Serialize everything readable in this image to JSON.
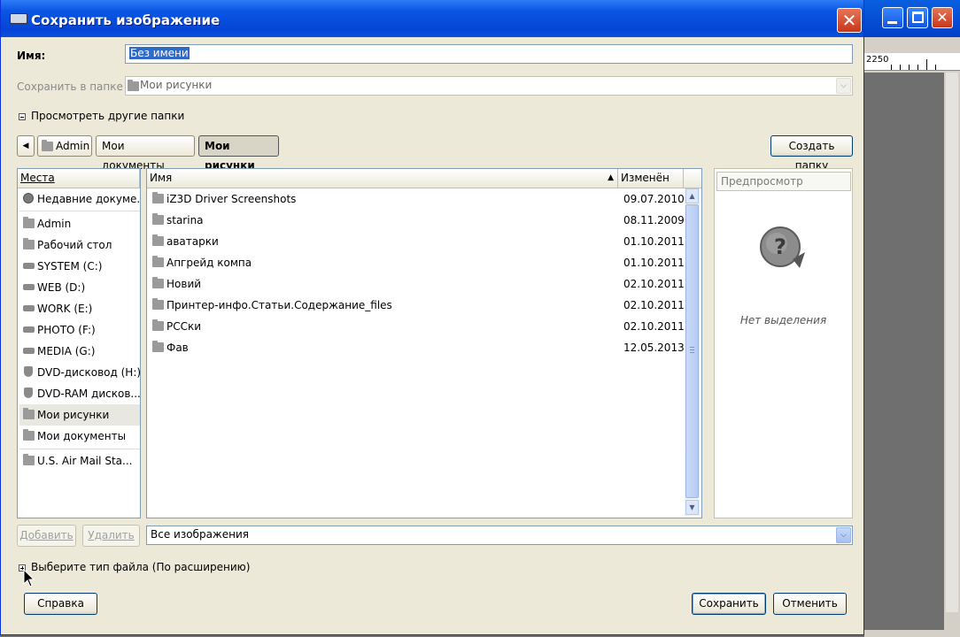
{
  "background_app": {
    "ruler_label": "2250"
  },
  "dialog": {
    "title": "Сохранить изображение",
    "name_label": "Имя:",
    "name_value": "Без имени",
    "folder_label": "Сохранить в папке",
    "folder_value": "Мои рисунки",
    "browse_expander": "Просмотреть другие папки",
    "path": [
      "Admin",
      "Мои документы",
      "Мои рисунки"
    ],
    "create_folder_label": "Создать папку",
    "places": {
      "header": "Места",
      "items": [
        {
          "label": "Недавние докуме...",
          "icon": "recent-icon"
        },
        {
          "label": "Admin",
          "icon": "folder-icon"
        },
        {
          "label": "Рабочий стол",
          "icon": "folder-icon"
        },
        {
          "label": "SYSTEM (C:)",
          "icon": "drive-icon"
        },
        {
          "label": "WEB (D:)",
          "icon": "drive-icon"
        },
        {
          "label": "WORK (E:)",
          "icon": "drive-icon"
        },
        {
          "label": "PHOTO (F:)",
          "icon": "drive-icon"
        },
        {
          "label": "MEDIA (G:)",
          "icon": "drive-icon"
        },
        {
          "label": "DVD-дисковод (H:)",
          "icon": "dvd-icon"
        },
        {
          "label": "DVD-RAM дисков...",
          "icon": "dvd-icon"
        },
        {
          "label": "Мои рисунки",
          "icon": "folder-icon"
        },
        {
          "label": "Мои документы",
          "icon": "folder-icon"
        },
        {
          "label": "U.S. Air Mail Sta...",
          "icon": "folder-icon"
        }
      ],
      "add_label": "Добавить",
      "remove_label": "Удалить"
    },
    "files": {
      "header_name": "Имя",
      "header_modified": "Изменён",
      "rows": [
        {
          "name": "iZ3D Driver Screenshots",
          "date": "09.07.2010"
        },
        {
          "name": "starina",
          "date": "08.11.2009"
        },
        {
          "name": "аватарки",
          "date": "01.10.2011"
        },
        {
          "name": "Апгрейд компа",
          "date": "01.10.2011"
        },
        {
          "name": "Новий",
          "date": "02.10.2011"
        },
        {
          "name": "Принтер-инфо.Статьи.Содержание_files",
          "date": "02.10.2011"
        },
        {
          "name": "РССки",
          "date": "02.10.2011"
        },
        {
          "name": "Фав",
          "date": "12.05.2013"
        }
      ]
    },
    "preview": {
      "header": "Предпросмотр",
      "no_selection": "Нет выделения"
    },
    "filter_value": "Все изображения",
    "filetype_expander": "Выберите тип файла (По расширению)",
    "help_label": "Справка",
    "save_label": "Сохранить",
    "cancel_label": "Отменить"
  }
}
